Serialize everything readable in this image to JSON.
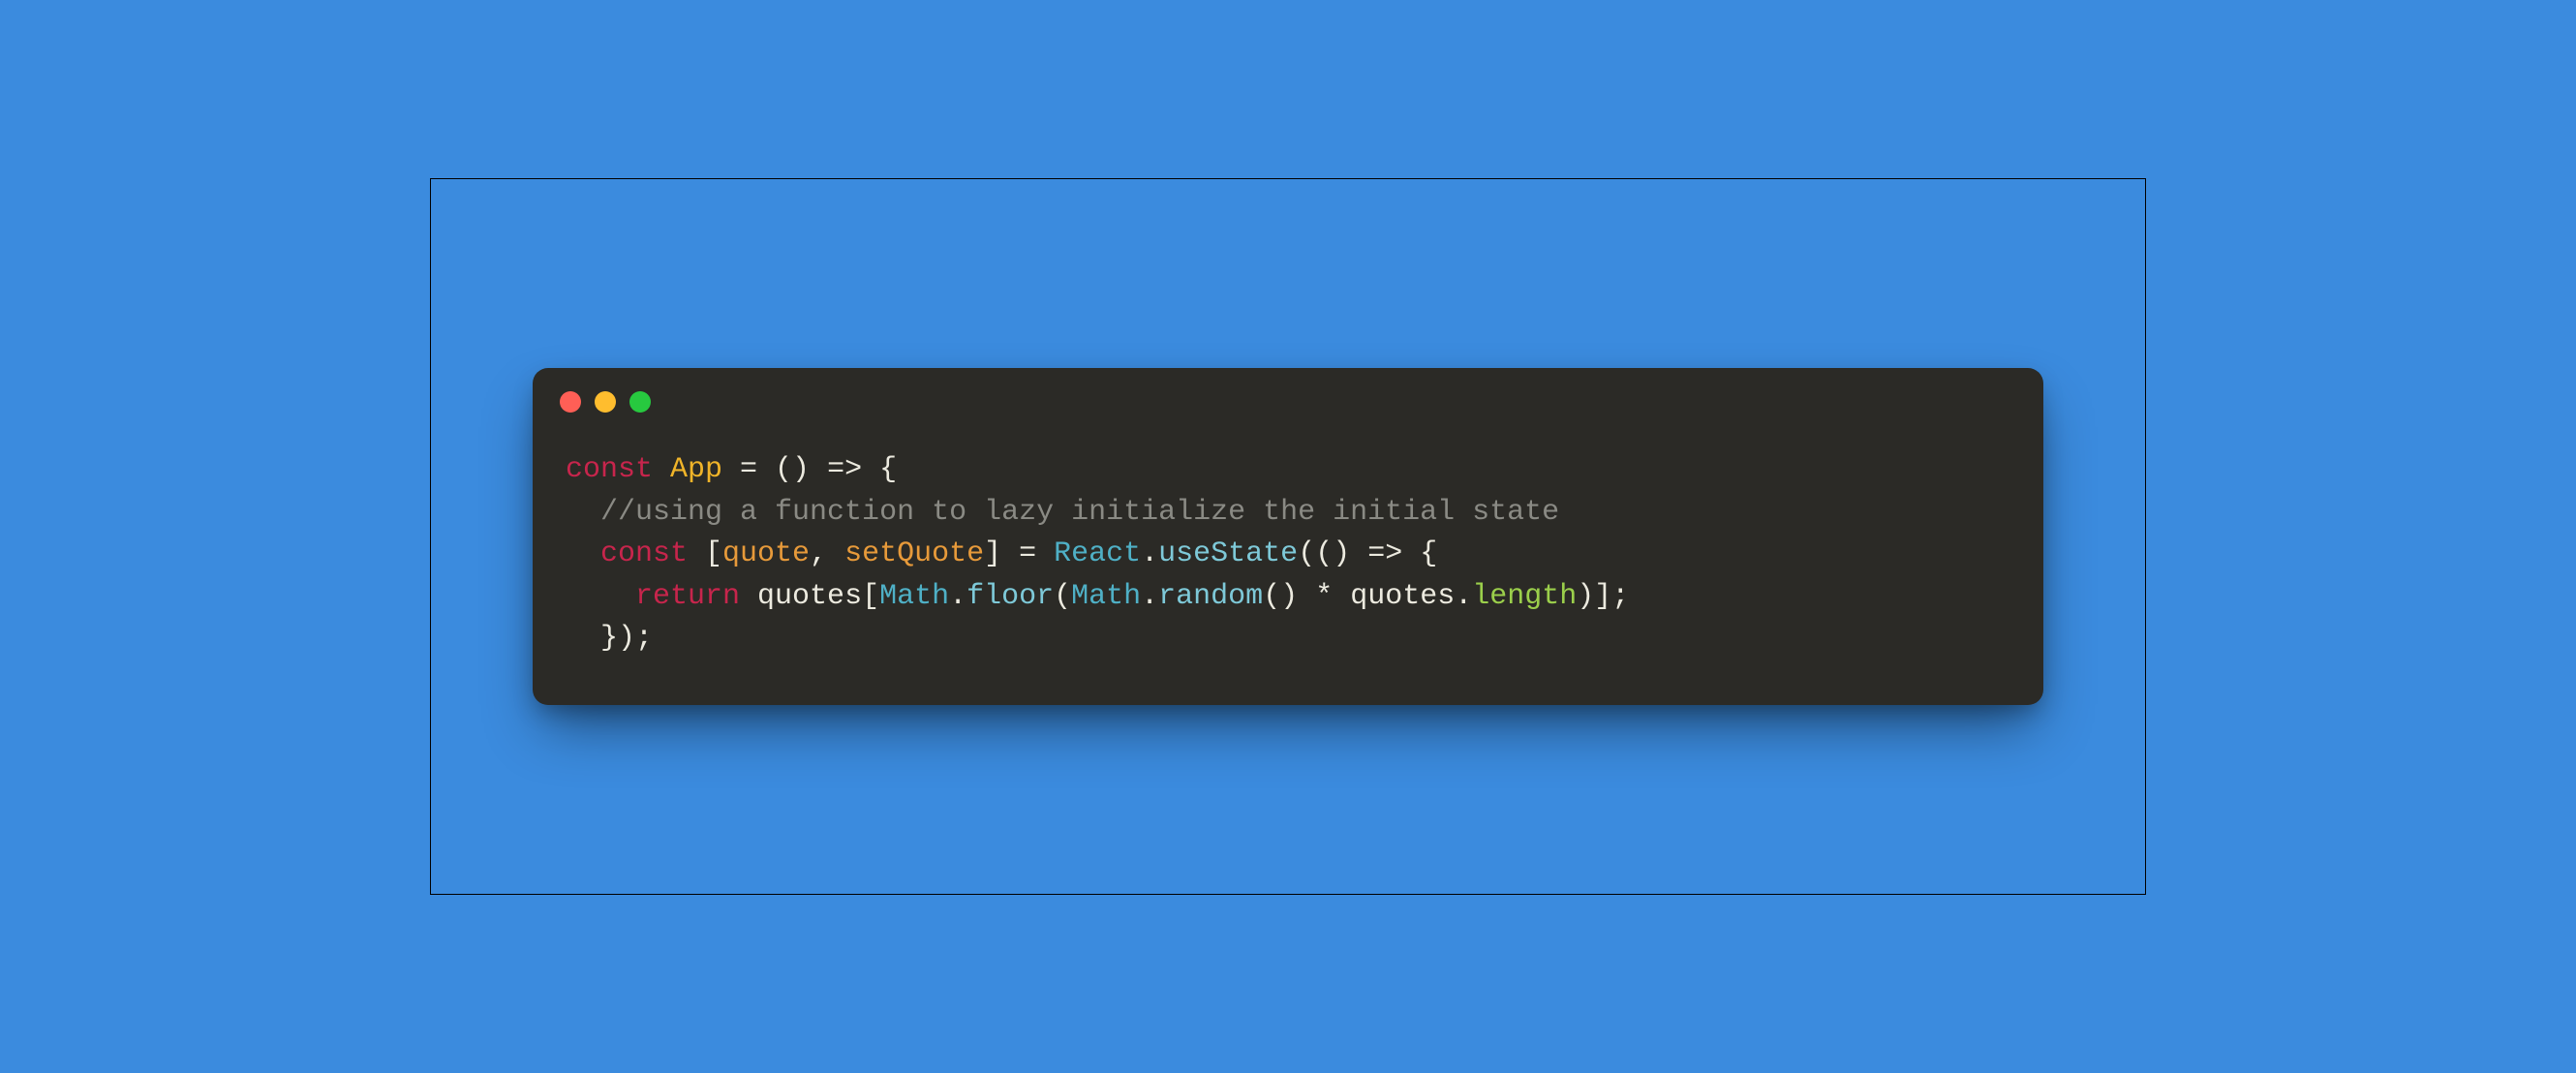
{
  "window": {
    "dots": {
      "red": "#ff5f56",
      "yellow": "#ffbd2e",
      "green": "#27c93f"
    }
  },
  "code": {
    "line1": {
      "kw_const": "const",
      "sp1": " ",
      "fn": "App",
      "rest": " = () => {"
    },
    "line2": {
      "indent": "  ",
      "comment": "//using a function to lazy initialize the initial state"
    },
    "line3": {
      "indent": "  ",
      "kw_const": "const",
      "sp1": " [",
      "var1": "quote",
      "sep": ", ",
      "var2": "setQuote",
      "after_bracket": "] = ",
      "class1": "React",
      "dot1": ".",
      "method1": "useState",
      "tail": "(() => {"
    },
    "line4": {
      "indent": "    ",
      "kw_return": "return",
      "sp1": " quotes[",
      "class_math1": "Math",
      "dot1": ".",
      "m_floor": "floor",
      "open": "(",
      "class_math2": "Math",
      "dot2": ".",
      "m_random": "random",
      "parens": "() * quotes.",
      "prop_len": "length",
      "close": ")];"
    },
    "line5": {
      "indent": "  ",
      "text": "});"
    }
  }
}
